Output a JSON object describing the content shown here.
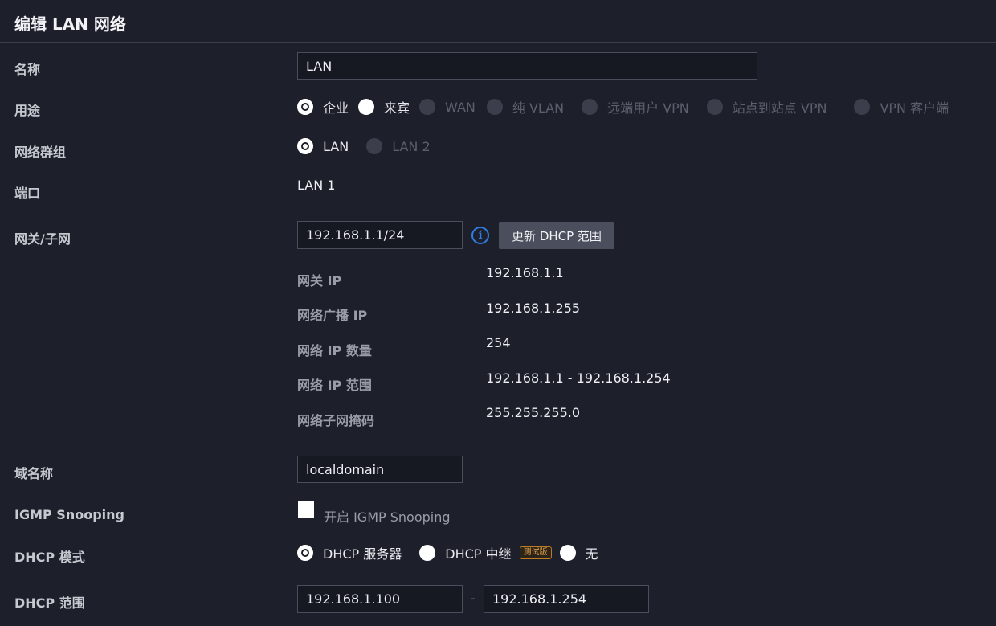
{
  "title": "编辑 LAN 网络",
  "labels": {
    "name": "名称",
    "purpose": "用途",
    "network_group": "网络群组",
    "port": "端口",
    "gateway_subnet": "网关/子网",
    "domain_name": "域名称",
    "igmp": "IGMP Snooping",
    "dhcp_mode": "DHCP 模式",
    "dhcp_range": "DHCP 范围"
  },
  "name_value": "LAN",
  "purpose_options": [
    "企业",
    "来宾",
    "WAN",
    "纯 VLAN",
    "远端用户 VPN",
    "站点到站点 VPN",
    "VPN 客户端"
  ],
  "network_group_options": [
    "LAN",
    "LAN 2"
  ],
  "port_value": "LAN 1",
  "gateway_value": "192.168.1.1/24",
  "info_icon": "i",
  "update_dhcp_button": "更新 DHCP 范围",
  "subnet_info": {
    "gateway_ip_label": "网关 IP",
    "gateway_ip": "192.168.1.1",
    "broadcast_ip_label": "网络广播 IP",
    "broadcast_ip": "192.168.1.255",
    "ip_count_label": "网络 IP 数量",
    "ip_count": "254",
    "ip_range_label": "网络 IP 范围",
    "ip_range": "192.168.1.1 - 192.168.1.254",
    "subnet_mask_label": "网络子网掩码",
    "subnet_mask": "255.255.255.0"
  },
  "domain_value": "localdomain",
  "igmp_checkbox_label": "开启 IGMP Snooping",
  "dhcp_mode_options": {
    "server": "DHCP 服务器",
    "relay": "DHCP 中继",
    "beta_badge": "测试版",
    "none": "无"
  },
  "dhcp_range_start": "192.168.1.100",
  "dhcp_range_separator": "-",
  "dhcp_range_end": "192.168.1.254",
  "colors": {
    "background": "#1d1f2b",
    "info_blue": "#2f7de1",
    "beta_orange": "#f0a84b"
  }
}
